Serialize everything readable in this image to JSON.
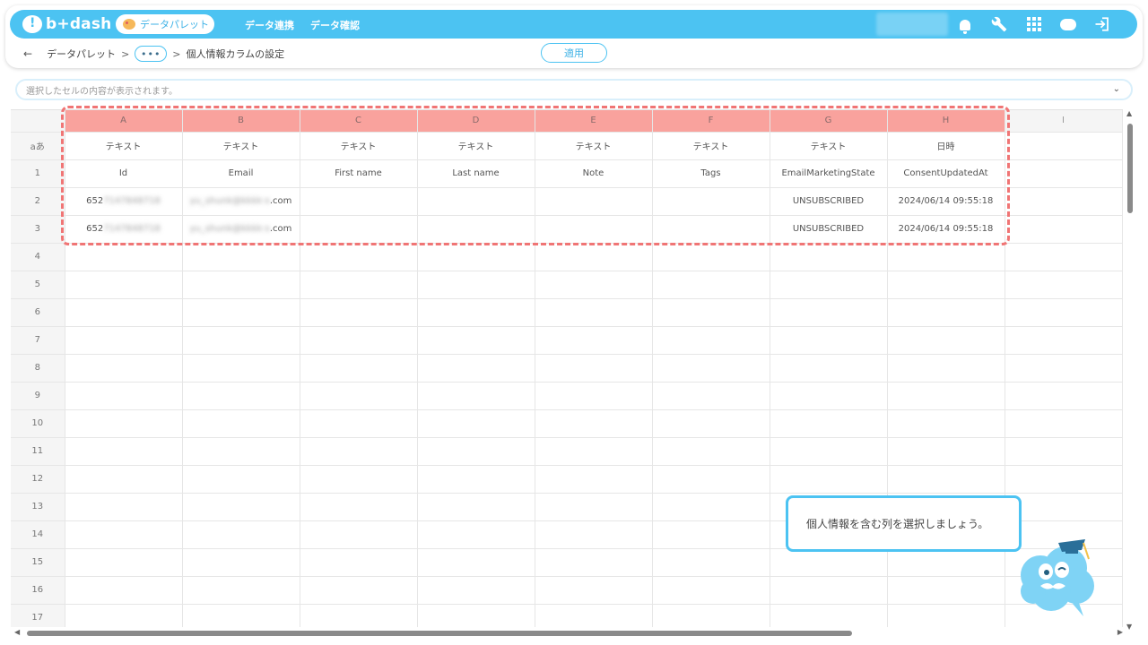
{
  "app": {
    "logo_text": "b+dash",
    "palette_label": "データパレット",
    "nav": [
      "データ連携",
      "データ確認"
    ]
  },
  "breadcrumb": {
    "items": [
      "データパレット",
      "•••",
      "個人情報カラムの設定"
    ],
    "sep": ">"
  },
  "apply_label": "適用",
  "cell_bar_placeholder": "選択したセルの内容が表示されます。",
  "sheet": {
    "corner_label": "aあ",
    "columns": [
      "A",
      "B",
      "C",
      "D",
      "E",
      "F",
      "G",
      "H",
      "I"
    ],
    "types": [
      "テキスト",
      "テキスト",
      "テキスト",
      "テキスト",
      "テキスト",
      "テキスト",
      "テキスト",
      "日時",
      ""
    ],
    "rows": [
      {
        "num": "1",
        "cells": [
          "Id",
          "Email",
          "First name",
          "Last name",
          "Note",
          "Tags",
          "EmailMarketingState",
          "ConsentUpdatedAt",
          ""
        ]
      },
      {
        "num": "2",
        "cells": [
          "652",
          "",
          "",
          "",
          "",
          "",
          "UNSUBSCRIBED",
          "2024/06/14 09:55:18",
          ""
        ],
        "id_blur": "7147848718",
        "email_blur": "yu_shunk@kkkk-s",
        "email_suffix": ".com"
      },
      {
        "num": "3",
        "cells": [
          "652",
          "",
          "",
          "",
          "",
          "",
          "UNSUBSCRIBED",
          "2024/06/14 09:55:18",
          ""
        ],
        "id_blur": "7147848718",
        "email_blur": "yu_shunk@kkkk-s",
        "email_suffix": ".com"
      }
    ],
    "empty_rows": [
      "4",
      "5",
      "6",
      "7",
      "8",
      "9",
      "10",
      "11",
      "12",
      "13",
      "14",
      "15",
      "16",
      "17"
    ]
  },
  "tooltip_text": "個人情報を含む列を選択しましょう。",
  "colors": {
    "brand": "#4cc3f2",
    "selected_col": "#f9a29d",
    "selection_border": "#f07575"
  }
}
